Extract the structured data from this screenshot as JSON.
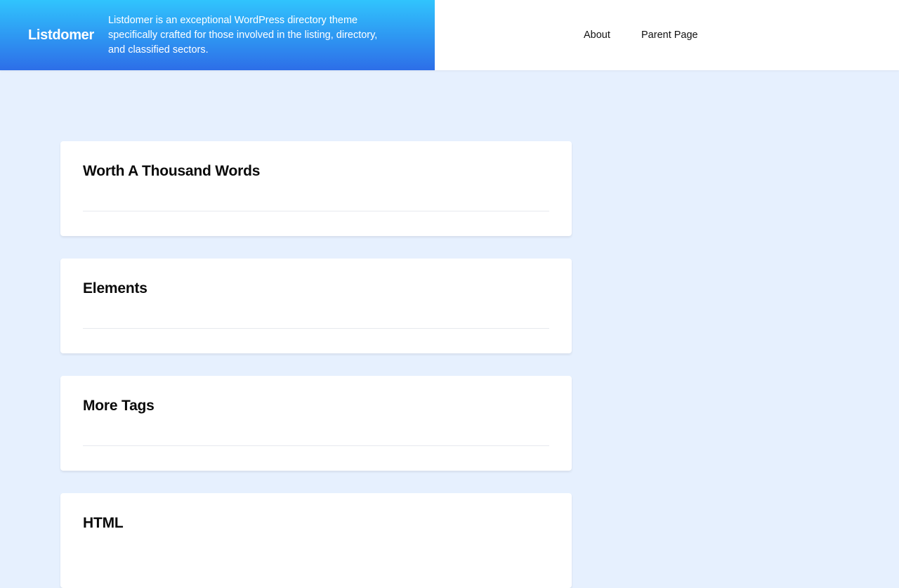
{
  "header": {
    "logo": "Listdomer",
    "tagline": "Listdomer is an exceptional WordPress directory theme specifically crafted for those involved in the listing, directory, and classified sectors.",
    "nav": [
      {
        "label": "About"
      },
      {
        "label": "Parent Page"
      }
    ]
  },
  "cards": [
    {
      "title": "Worth A Thousand Words"
    },
    {
      "title": "Elements"
    },
    {
      "title": "More Tags"
    },
    {
      "title": "HTML"
    }
  ],
  "colors": {
    "page_background": "#e6f0fe",
    "header_gradient_top": "#30c4fd",
    "header_gradient_bottom": "#2d6ee8",
    "card_background": "#ffffff"
  }
}
